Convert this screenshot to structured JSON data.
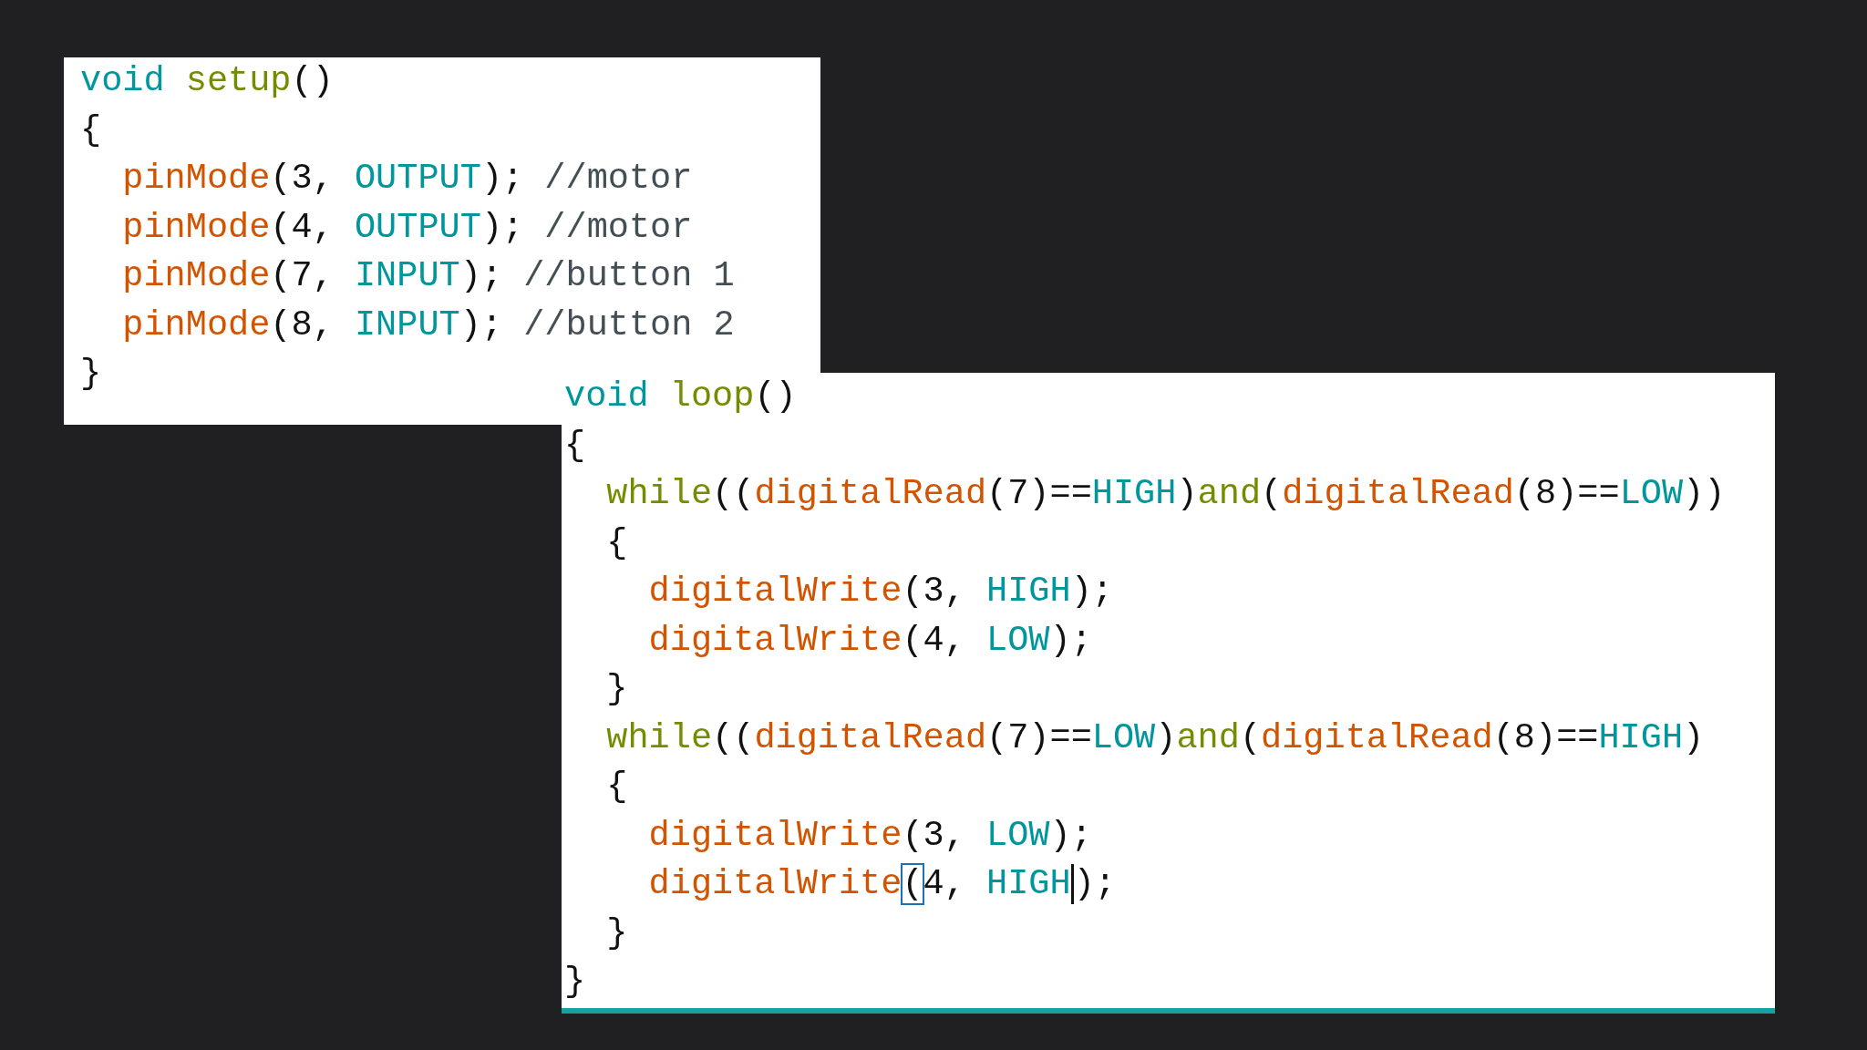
{
  "panels": [
    {
      "lines": [
        {
          "tokens": [
            {
              "kind": "type",
              "text": "void "
            },
            {
              "kind": "keyword",
              "text": "setup"
            },
            {
              "kind": "plain",
              "text": "()"
            }
          ]
        },
        {
          "tokens": [
            {
              "kind": "plain",
              "text": "{"
            }
          ]
        },
        {
          "tokens": [
            {
              "kind": "function",
              "text": "  pinMode"
            },
            {
              "kind": "plain",
              "text": "(3, "
            },
            {
              "kind": "constant",
              "text": "OUTPUT"
            },
            {
              "kind": "plain",
              "text": "); "
            },
            {
              "kind": "comment",
              "text": "//motor"
            }
          ]
        },
        {
          "tokens": [
            {
              "kind": "function",
              "text": "  pinMode"
            },
            {
              "kind": "plain",
              "text": "(4, "
            },
            {
              "kind": "constant",
              "text": "OUTPUT"
            },
            {
              "kind": "plain",
              "text": "); "
            },
            {
              "kind": "comment",
              "text": "//motor"
            }
          ]
        },
        {
          "tokens": [
            {
              "kind": "function",
              "text": "  pinMode"
            },
            {
              "kind": "plain",
              "text": "(7, "
            },
            {
              "kind": "constant",
              "text": "INPUT"
            },
            {
              "kind": "plain",
              "text": "); "
            },
            {
              "kind": "comment",
              "text": "//button 1"
            }
          ]
        },
        {
          "tokens": [
            {
              "kind": "function",
              "text": "  pinMode"
            },
            {
              "kind": "plain",
              "text": "(8, "
            },
            {
              "kind": "constant",
              "text": "INPUT"
            },
            {
              "kind": "plain",
              "text": "); "
            },
            {
              "kind": "comment",
              "text": "//button 2"
            }
          ]
        },
        {
          "tokens": [
            {
              "kind": "plain",
              "text": "}"
            }
          ]
        }
      ]
    },
    {
      "lines": [
        {
          "tokens": [
            {
              "kind": "type",
              "text": "void "
            },
            {
              "kind": "keyword",
              "text": "loop"
            },
            {
              "kind": "plain",
              "text": "()"
            }
          ]
        },
        {
          "tokens": [
            {
              "kind": "plain",
              "text": "{"
            }
          ]
        },
        {
          "tokens": [
            {
              "kind": "keyword",
              "text": "  while"
            },
            {
              "kind": "plain",
              "text": "(("
            },
            {
              "kind": "function",
              "text": "digitalRead"
            },
            {
              "kind": "plain",
              "text": "(7)=="
            },
            {
              "kind": "constant",
              "text": "HIGH"
            },
            {
              "kind": "plain",
              "text": ")"
            },
            {
              "kind": "keyword",
              "text": "and"
            },
            {
              "kind": "plain",
              "text": "("
            },
            {
              "kind": "function",
              "text": "digitalRead"
            },
            {
              "kind": "plain",
              "text": "(8)=="
            },
            {
              "kind": "constant",
              "text": "LOW"
            },
            {
              "kind": "plain",
              "text": "))"
            }
          ]
        },
        {
          "tokens": [
            {
              "kind": "plain",
              "text": "  {"
            }
          ]
        },
        {
          "tokens": [
            {
              "kind": "function",
              "text": "    digitalWrite"
            },
            {
              "kind": "plain",
              "text": "(3, "
            },
            {
              "kind": "constant",
              "text": "HIGH"
            },
            {
              "kind": "plain",
              "text": ");"
            }
          ]
        },
        {
          "tokens": [
            {
              "kind": "function",
              "text": "    digitalWrite"
            },
            {
              "kind": "plain",
              "text": "(4, "
            },
            {
              "kind": "constant",
              "text": "LOW"
            },
            {
              "kind": "plain",
              "text": ");"
            }
          ]
        },
        {
          "tokens": [
            {
              "kind": "plain",
              "text": "  }"
            }
          ]
        },
        {
          "tokens": [
            {
              "kind": "keyword",
              "text": "  while"
            },
            {
              "kind": "plain",
              "text": "(("
            },
            {
              "kind": "function",
              "text": "digitalRead"
            },
            {
              "kind": "plain",
              "text": "(7)=="
            },
            {
              "kind": "constant",
              "text": "LOW"
            },
            {
              "kind": "plain",
              "text": ")"
            },
            {
              "kind": "keyword",
              "text": "and"
            },
            {
              "kind": "plain",
              "text": "("
            },
            {
              "kind": "function",
              "text": "digitalRead"
            },
            {
              "kind": "plain",
              "text": "(8)=="
            },
            {
              "kind": "constant",
              "text": "HIGH"
            },
            {
              "kind": "plain",
              "text": ")"
            }
          ]
        },
        {
          "tokens": [
            {
              "kind": "plain",
              "text": "  {"
            }
          ]
        },
        {
          "tokens": [
            {
              "kind": "function",
              "text": "    digitalWrite"
            },
            {
              "kind": "plain",
              "text": "(3, "
            },
            {
              "kind": "constant",
              "text": "LOW"
            },
            {
              "kind": "plain",
              "text": ");"
            }
          ]
        },
        {
          "tokens": [
            {
              "kind": "function",
              "text": "    digitalWrite"
            },
            {
              "kind": "matched_bracket",
              "text": "("
            },
            {
              "kind": "plain",
              "text": "4, "
            },
            {
              "kind": "constant",
              "text": "HIGH"
            },
            {
              "kind": "caret"
            },
            {
              "kind": "plain",
              "text": ");"
            }
          ]
        },
        {
          "tokens": [
            {
              "kind": "plain",
              "text": "  }"
            }
          ]
        },
        {
          "tokens": [
            {
              "kind": "plain",
              "text": "}"
            }
          ]
        }
      ]
    }
  ]
}
